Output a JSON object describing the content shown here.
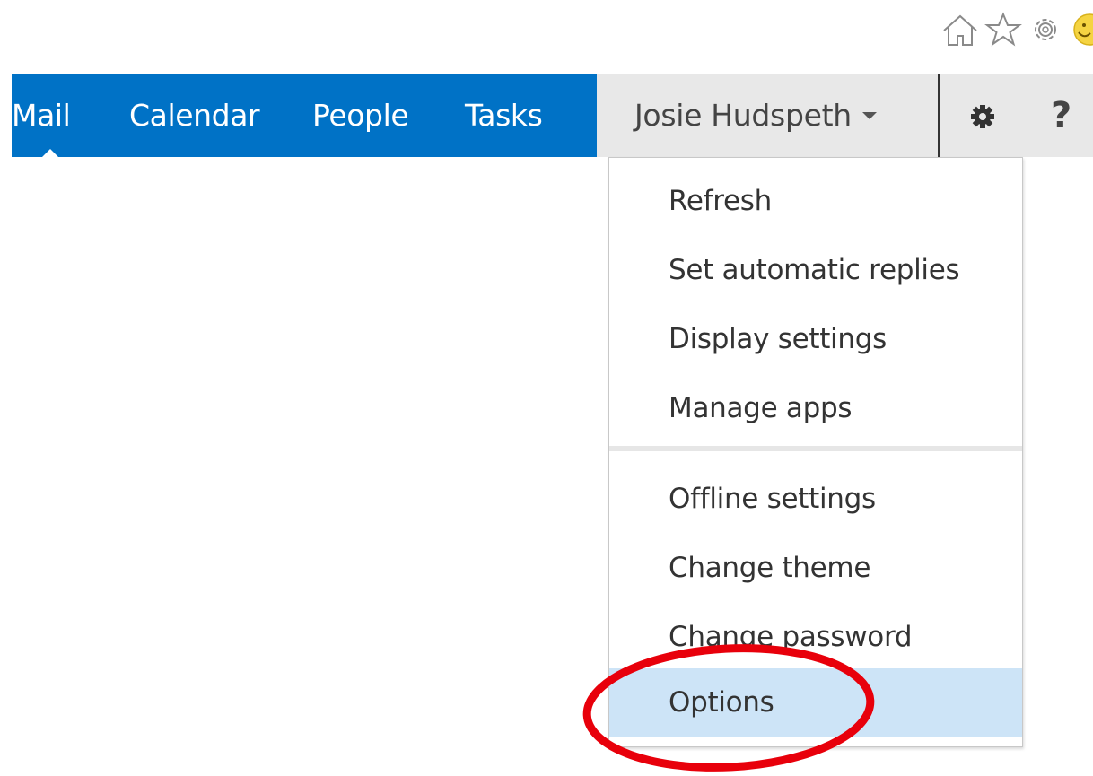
{
  "browser_toolbar": {
    "icons": [
      "home-icon",
      "favorites-star-icon",
      "tools-gear-icon",
      "smiley-feedback-icon"
    ]
  },
  "nav": {
    "items": [
      {
        "label": "Mail",
        "active": true
      },
      {
        "label": "Calendar",
        "active": false
      },
      {
        "label": "People",
        "active": false
      },
      {
        "label": "Tasks",
        "active": false
      }
    ]
  },
  "user": {
    "name": "Josie Hudspeth"
  },
  "toolbar": {
    "settings_icon": "gear-icon",
    "help_label": "?"
  },
  "settings_menu": {
    "group1": [
      "Refresh",
      "Set automatic replies",
      "Display settings",
      "Manage apps"
    ],
    "group2": [
      "Offline settings",
      "Change theme",
      "Change password",
      "Options"
    ],
    "highlighted_item": "Options"
  },
  "colors": {
    "nav_background": "#0072c6",
    "user_area_background": "#e8e8e8",
    "highlight": "#cde4f7",
    "annotation": "#e8000b"
  }
}
